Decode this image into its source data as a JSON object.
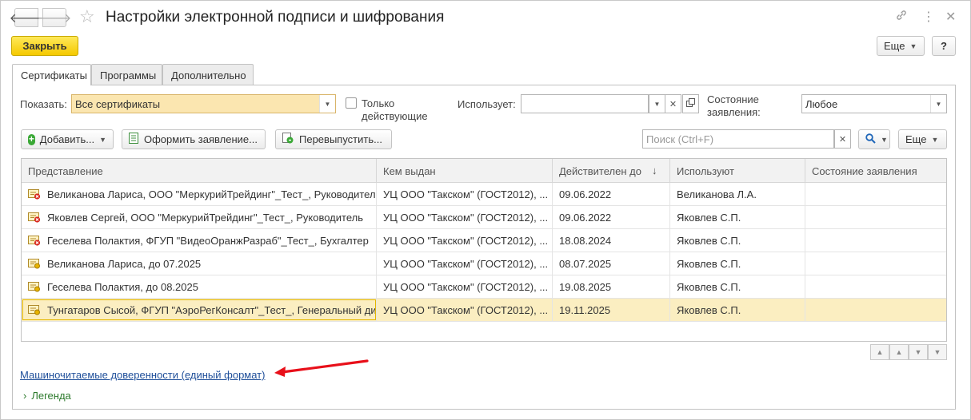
{
  "window": {
    "title": "Настройки электронной подписи и шифрования"
  },
  "commandbar": {
    "close_label": "Закрыть",
    "more_label": "Еще",
    "help_label": "?"
  },
  "tabs": [
    {
      "label": "Сертификаты"
    },
    {
      "label": "Программы"
    },
    {
      "label": "Дополнительно"
    }
  ],
  "filters": {
    "show_label": "Показать:",
    "show_value": "Все сертификаты",
    "only_active_label_line1": "Только",
    "only_active_label_line2": "действующие",
    "uses_label": "Использует:",
    "uses_value": "",
    "status_label_line1": "Состояние",
    "status_label_line2": "заявления:",
    "status_value": "Любое"
  },
  "toolbar": {
    "add_label": "Добавить...",
    "apply_label": "Оформить заявление...",
    "reissue_label": "Перевыпустить...",
    "search_placeholder": "Поиск (Ctrl+F)",
    "more_label": "Еще"
  },
  "table": {
    "columns": [
      "Представление",
      "Кем выдан",
      "Действителен до",
      "Используют",
      "Состояние заявления"
    ],
    "rows": [
      {
        "name": "Великанова Лариса, ООО \"МеркурийТрейдинг\"_Тест_, Руководитель",
        "issuer": "УЦ ООО \"Такском\" (ГОСТ2012), ...",
        "valid": "09.06.2022",
        "users": "Великанова Л.А.",
        "status": "",
        "expired": true
      },
      {
        "name": "Яковлев Сергей, ООО \"МеркурийТрейдинг\"_Тест_, Руководитель",
        "issuer": "УЦ ООО \"Такском\" (ГОСТ2012), ...",
        "valid": "09.06.2022",
        "users": "Яковлев С.П.",
        "status": "",
        "expired": true
      },
      {
        "name": "Геселева Полактия, ФГУП \"ВидеоОранжРазраб\"_Тест_, Бухгалтер",
        "issuer": "УЦ ООО \"Такском\" (ГОСТ2012), ...",
        "valid": "18.08.2024",
        "users": "Яковлев С.П.",
        "status": "",
        "expired": true
      },
      {
        "name": "Великанова Лариса, до 07.2025",
        "issuer": "УЦ ООО \"Такском\" (ГОСТ2012), ...",
        "valid": "08.07.2025",
        "users": "Яковлев С.П.",
        "status": "",
        "expired": false
      },
      {
        "name": "Геселева Полактия, до 08.2025",
        "issuer": "УЦ ООО \"Такском\" (ГОСТ2012), ...",
        "valid": "19.08.2025",
        "users": "Яковлев С.П.",
        "status": "",
        "expired": false
      },
      {
        "name": "Тунгатаров Сысой, ФГУП \"АэроРегКонсалт\"_Тест_, Генеральный директор",
        "issuer": "УЦ ООО \"Такском\" (ГОСТ2012), ...",
        "valid": "19.11.2025",
        "users": "Яковлев С.П.",
        "status": "",
        "expired": false
      }
    ]
  },
  "footer": {
    "link_label": "Машиночитаемые доверенности (единый формат)",
    "legend_label": "Легенда"
  },
  "colors": {
    "accent_yellow": "#f5c900",
    "selected_row": "#fbeec1",
    "link": "#1f4f9a",
    "legend": "#2c7a2c",
    "arrow": "#e8101a"
  }
}
